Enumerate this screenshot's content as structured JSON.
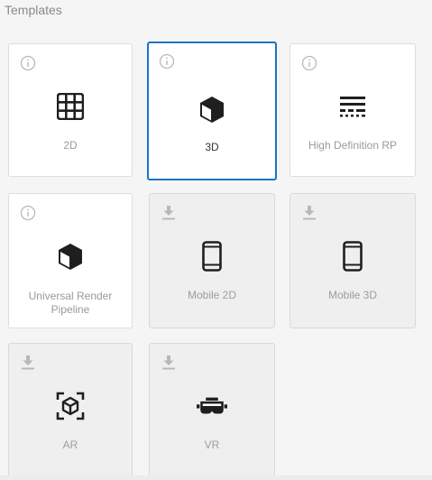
{
  "section": {
    "title": "Templates"
  },
  "templates": [
    {
      "label": "2D",
      "badge": "info-icon",
      "icon": "grid-icon"
    },
    {
      "label": "3D",
      "badge": "info-icon",
      "icon": "cube-icon",
      "selected": true
    },
    {
      "label": "High Definition RP",
      "badge": "info-icon",
      "icon": "hdrp-lines-icon"
    },
    {
      "label": "Universal Render Pipeline",
      "badge": "info-icon",
      "icon": "cube-icon"
    },
    {
      "label": "Mobile 2D",
      "badge": "download-icon",
      "icon": "smartphone-icon"
    },
    {
      "label": "Mobile 3D",
      "badge": "download-icon",
      "icon": "smartphone-icon"
    },
    {
      "label": "AR",
      "badge": "download-icon",
      "icon": "ar-cube-icon"
    },
    {
      "label": "VR",
      "badge": "download-icon",
      "icon": "vr-headset-icon"
    }
  ],
  "colors": {
    "selected_border": "#1a73c8",
    "card_bg": "#ffffff",
    "disabled_bg": "#efefef",
    "icon": "#1f1f1f",
    "badge": "#b8b8b8"
  }
}
